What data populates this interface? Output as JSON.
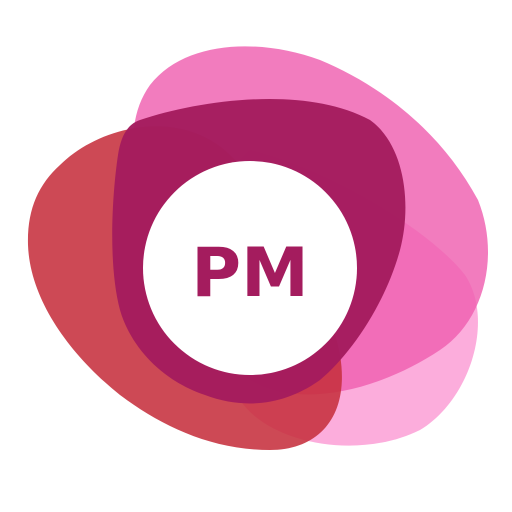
{
  "logo": {
    "monogram": "PM",
    "colors": {
      "background": "#ffffff",
      "light_pink": "#fb9fd6",
      "mid_pink": "#f06db6",
      "red": "#c9343e",
      "magenta_core": "#a41c5e",
      "badge_circle": "#ffffff",
      "monogram_text": "#a41c5e"
    }
  }
}
